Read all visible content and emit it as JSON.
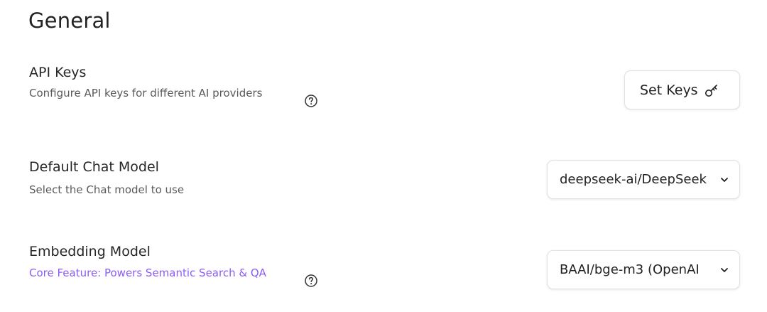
{
  "page": {
    "title": "General"
  },
  "api_keys": {
    "title": "API Keys",
    "description": "Configure API keys for different AI providers",
    "button_label": "Set Keys",
    "help_icon": "question-circle-icon",
    "button_icon": "key-icon"
  },
  "chat_model": {
    "title": "Default Chat Model",
    "description": "Select the Chat model to use",
    "selected": "deepseek-ai/DeepSeek",
    "dropdown_icon": "chevron-down-icon"
  },
  "embedding_model": {
    "title": "Embedding Model",
    "description": "Core Feature: Powers Semantic Search & QA",
    "selected": "BAAI/bge-m3 (OpenAI",
    "help_icon": "question-circle-icon",
    "dropdown_icon": "chevron-down-icon"
  },
  "colors": {
    "accent": "#8b5cf6",
    "text": "#262626",
    "muted": "#5a5a5a",
    "border": "#e2e2e2"
  }
}
